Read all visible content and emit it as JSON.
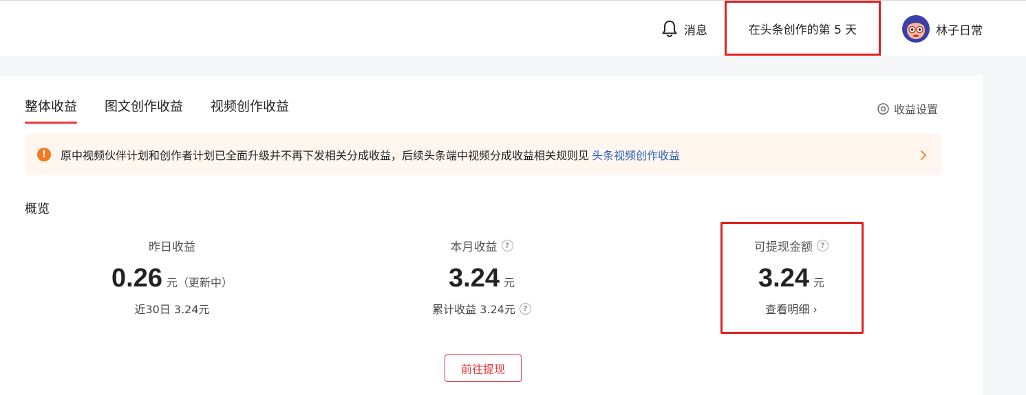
{
  "header": {
    "messages_label": "消息",
    "creation_days": "在头条创作的第 5 天",
    "username": "林子日常"
  },
  "tabs": [
    {
      "label": "整体收益",
      "active": true
    },
    {
      "label": "图文创作收益",
      "active": false
    },
    {
      "label": "视频创作收益",
      "active": false
    }
  ],
  "settings_label": "收益设置",
  "notice": {
    "text": "原中视频伙伴计划和创作者计划已全面升级并不再下发相关分成收益，后续头条端中视频分成收益相关规则见",
    "link": "头条视频创作收益"
  },
  "overview": {
    "title": "概览",
    "yesterday": {
      "label": "昨日收益",
      "value": "0.26",
      "unit": "元（更新中）",
      "sub": "近30日 3.24元"
    },
    "month": {
      "label": "本月收益",
      "value": "3.24",
      "unit": "元",
      "sub": "累计收益 3.24元"
    },
    "withdrawable": {
      "label": "可提现金额",
      "value": "3.24",
      "unit": "元",
      "detail": "查看明细 ›"
    }
  },
  "withdraw_button": "前往提现",
  "colors": {
    "accent": "#e8383d",
    "highlight_box": "#e02020",
    "link": "#2a62b8",
    "warning": "#f47920"
  }
}
